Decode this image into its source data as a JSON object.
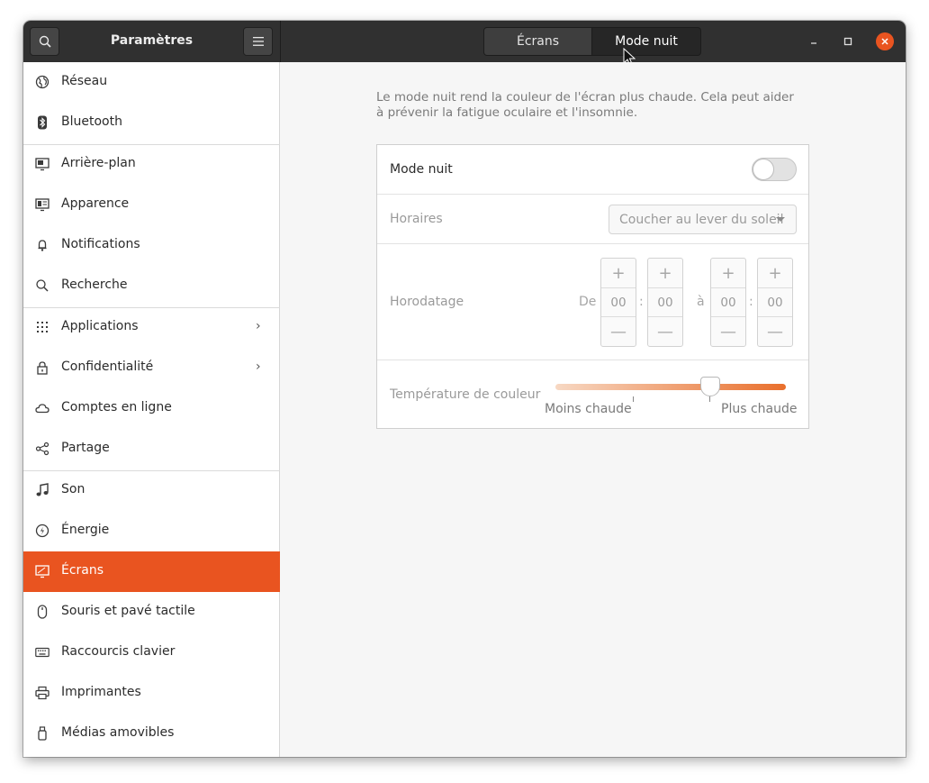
{
  "header": {
    "app_title": "Paramètres",
    "search_icon": "search-icon",
    "menu_icon": "hamburger-menu-icon",
    "tabs": [
      {
        "label": "Écrans"
      },
      {
        "label": "Mode nuit"
      }
    ],
    "window_controls": [
      "minimize-icon",
      "maximize-icon",
      "close-icon"
    ]
  },
  "sidebar": {
    "items": [
      {
        "label": "Réseau",
        "icon": "globe-icon"
      },
      {
        "label": "Bluetooth",
        "icon": "bluetooth-icon"
      },
      {
        "label": "Arrière-plan",
        "icon": "monitor-background-icon"
      },
      {
        "label": "Apparence",
        "icon": "appearance-icon"
      },
      {
        "label": "Notifications",
        "icon": "bell-icon"
      },
      {
        "label": "Recherche",
        "icon": "search-icon"
      },
      {
        "label": "Applications",
        "icon": "apps-grid-icon",
        "chevron": "›"
      },
      {
        "label": "Confidentialité",
        "icon": "lock-icon",
        "chevron": "›"
      },
      {
        "label": "Comptes en ligne",
        "icon": "cloud-icon"
      },
      {
        "label": "Partage",
        "icon": "share-icon"
      },
      {
        "label": "Son",
        "icon": "music-note-icon"
      },
      {
        "label": "Énergie",
        "icon": "power-icon"
      },
      {
        "label": "Écrans",
        "icon": "display-icon",
        "active": true
      },
      {
        "label": "Souris et pavé tactile",
        "icon": "mouse-icon"
      },
      {
        "label": "Raccourcis clavier",
        "icon": "keyboard-icon"
      },
      {
        "label": "Imprimantes",
        "icon": "printer-icon"
      },
      {
        "label": "Médias amovibles",
        "icon": "usb-drive-icon"
      }
    ],
    "accent_color": "#e95420"
  },
  "night_light": {
    "description": "Le mode nuit rend la couleur de l'écran plus chaude. Cela peut aider à prévenir la fatigue oculaire et l'insomnie.",
    "toggle_label": "Mode nuit",
    "toggle_on": false,
    "schedule_label": "Horaires",
    "schedule_value": "Coucher au lever du soleil",
    "times_label": "Horodatage",
    "from_label": "De",
    "to_label": "à",
    "separator": ":",
    "from_hours": "00",
    "from_minutes": "00",
    "to_hours": "00",
    "to_minutes": "00",
    "plus": "+",
    "minus": "—",
    "temperature_label": "Température de couleur",
    "temperature_min_label": "Moins chaude",
    "temperature_max_label": "Plus chaude",
    "temperature_level": 0.67
  }
}
